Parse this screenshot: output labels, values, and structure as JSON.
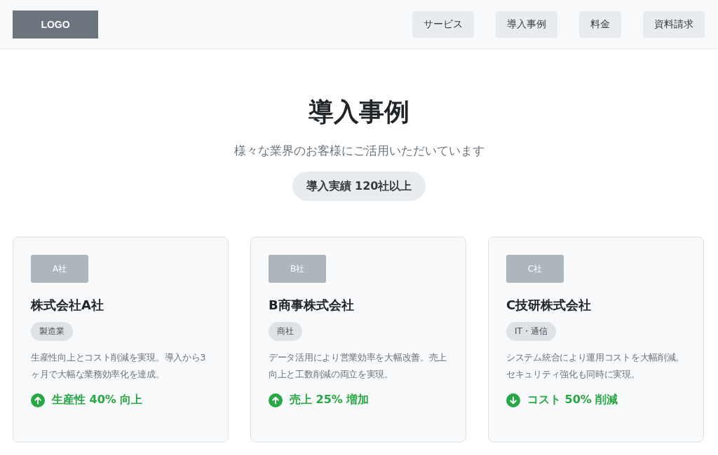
{
  "header": {
    "logo": "LOGO",
    "nav": [
      "サービス",
      "導入事例",
      "料金",
      "資料請求"
    ]
  },
  "hero": {
    "title": "導入事例",
    "subtitle": "様々な業界のお客様にご活用いただいています",
    "badge": "導入実績 120社以上"
  },
  "cases": [
    {
      "logo": "A社",
      "name": "株式会社A社",
      "industry": "製造業",
      "description": "生産性向上とコスト削減を実現。導入から3ヶ月で大幅な業務効率化を達成。",
      "result": "生産性 40% 向上",
      "kind": "up"
    },
    {
      "logo": "B社",
      "name": "B商事株式会社",
      "industry": "商社",
      "description": "データ活用により営業効率を大幅改善。売上向上と工数削減の両立を実現。",
      "result": "売上 25% 増加",
      "kind": "up"
    },
    {
      "logo": "C社",
      "name": "C技研株式会社",
      "industry": "IT・通信",
      "description": "システム統合により運用コストを大幅削減。セキュリティ強化も同時に実現。",
      "result": "コスト 50% 削減",
      "kind": "down"
    }
  ]
}
